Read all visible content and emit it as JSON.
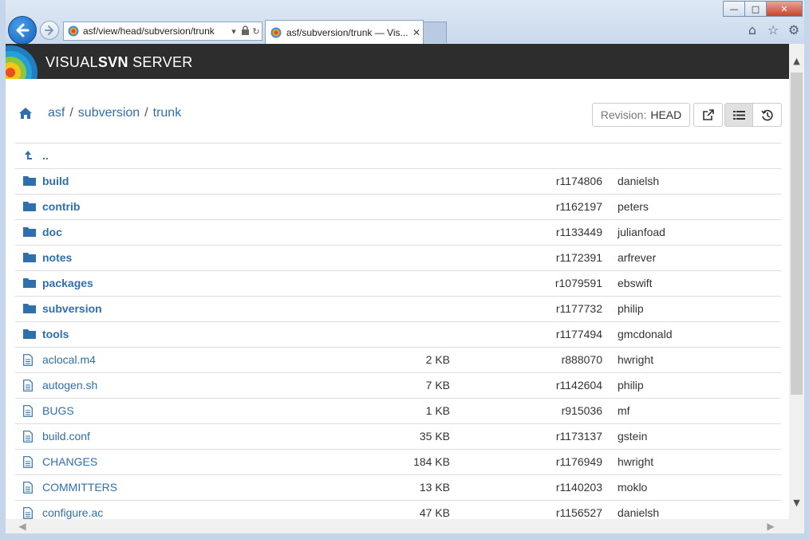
{
  "browser": {
    "address_url": "asf/view/head/subversion/trunk",
    "tab_title": "asf/subversion/trunk — Vis...",
    "window_buttons": {
      "minimize": "—",
      "maximize": "□",
      "close": "✕"
    }
  },
  "app": {
    "brand_light": "VISUAL",
    "brand_bold": "SVN",
    "brand_rest": " SERVER"
  },
  "breadcrumb": {
    "items": [
      "asf",
      "subversion",
      "trunk"
    ],
    "separator": "/"
  },
  "toolbar": {
    "revision_label": "Revision:",
    "revision_value": "HEAD"
  },
  "colors": {
    "link": "#2f6fad",
    "topbar": "#2d2d2d"
  },
  "entries": [
    {
      "type": "up",
      "name": "..",
      "size": "",
      "revision": "",
      "author": ""
    },
    {
      "type": "dir",
      "name": "build",
      "size": "",
      "revision": "r1174806",
      "author": "danielsh"
    },
    {
      "type": "dir",
      "name": "contrib",
      "size": "",
      "revision": "r1162197",
      "author": "peters"
    },
    {
      "type": "dir",
      "name": "doc",
      "size": "",
      "revision": "r1133449",
      "author": "julianfoad"
    },
    {
      "type": "dir",
      "name": "notes",
      "size": "",
      "revision": "r1172391",
      "author": "arfrever"
    },
    {
      "type": "dir",
      "name": "packages",
      "size": "",
      "revision": "r1079591",
      "author": "ebswift"
    },
    {
      "type": "dir",
      "name": "subversion",
      "size": "",
      "revision": "r1177732",
      "author": "philip"
    },
    {
      "type": "dir",
      "name": "tools",
      "size": "",
      "revision": "r1177494",
      "author": "gmcdonald"
    },
    {
      "type": "file",
      "name": "aclocal.m4",
      "size": "2 KB",
      "revision": "r888070",
      "author": "hwright"
    },
    {
      "type": "file",
      "name": "autogen.sh",
      "size": "7 KB",
      "revision": "r1142604",
      "author": "philip"
    },
    {
      "type": "file",
      "name": "BUGS",
      "size": "1 KB",
      "revision": "r915036",
      "author": "mf"
    },
    {
      "type": "file",
      "name": "build.conf",
      "size": "35 KB",
      "revision": "r1173137",
      "author": "gstein"
    },
    {
      "type": "file",
      "name": "CHANGES",
      "size": "184 KB",
      "revision": "r1176949",
      "author": "hwright"
    },
    {
      "type": "file",
      "name": "COMMITTERS",
      "size": "13 KB",
      "revision": "r1140203",
      "author": "moklo"
    },
    {
      "type": "file",
      "name": "configure.ac",
      "size": "47 KB",
      "revision": "r1156527",
      "author": "danielsh"
    }
  ]
}
